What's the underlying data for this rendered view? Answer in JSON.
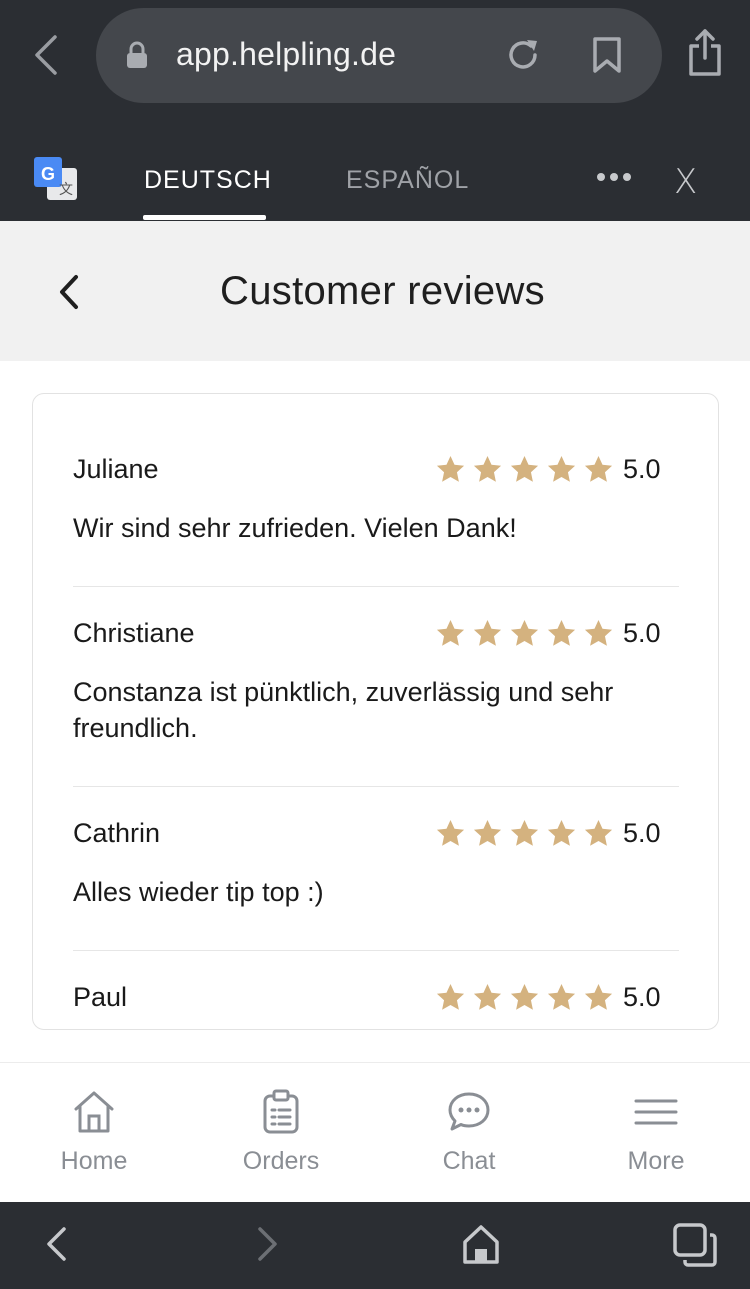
{
  "browser": {
    "url": "app.helpling.de",
    "icons": [
      "back-icon",
      "lock-icon",
      "reload-icon",
      "bookmark-icon",
      "share-icon"
    ]
  },
  "translate_bar": {
    "languages": [
      {
        "label": "DEUTSCH",
        "active": true
      },
      {
        "label": "ESPAÑOL",
        "active": false
      }
    ],
    "close_label": "X",
    "icon_glyphs": [
      "G",
      "文"
    ]
  },
  "header": {
    "title": "Customer reviews"
  },
  "reviews": [
    {
      "name": "Juliane",
      "stars": 5,
      "rating": "5.0",
      "text": "Wir sind sehr zufrieden. Vielen Dank!"
    },
    {
      "name": "Christiane",
      "stars": 5,
      "rating": "5.0",
      "text": "Constanza ist pünktlich, zuverlässig und sehr freundlich."
    },
    {
      "name": "Cathrin",
      "stars": 5,
      "rating": "5.0",
      "text": "Alles wieder tip top :)"
    },
    {
      "name": "Paul",
      "stars": 5,
      "rating": "5.0",
      "text": ""
    }
  ],
  "tabbar": {
    "items": [
      {
        "label": "Home",
        "icon": "home-icon"
      },
      {
        "label": "Orders",
        "icon": "clipboard-icon"
      },
      {
        "label": "Chat",
        "icon": "chat-bubble-icon"
      },
      {
        "label": "More",
        "icon": "menu-icon"
      }
    ]
  },
  "colors": {
    "browser_chrome": "#2b2e33",
    "star": "#d4b27f",
    "tab_inactive": "#8a8e94",
    "header_bg": "#f1f1f1"
  }
}
